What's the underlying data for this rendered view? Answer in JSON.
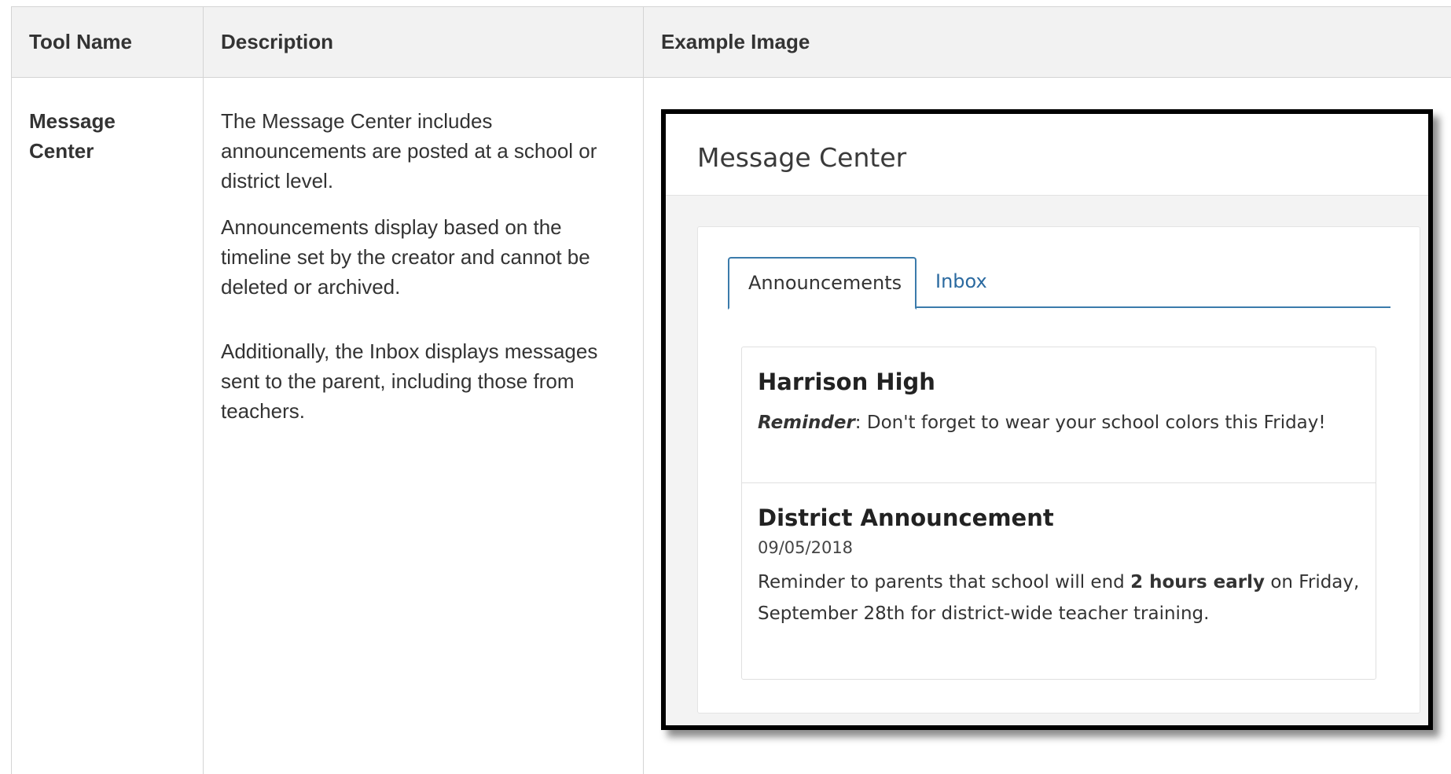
{
  "table": {
    "headers": {
      "tool_name": "Tool Name",
      "description": "Description",
      "example_image": "Example Image"
    },
    "rows": [
      {
        "tool_name": "Message Center",
        "description": [
          "The Message Center includes announcements are posted at a school or district level.",
          "Announcements display based on the timeline set by the creator and cannot be deleted or archived.",
          "Additionally, the Inbox displays messages sent to the parent, including those from teachers."
        ]
      }
    ]
  },
  "example": {
    "title": "Message Center",
    "tabs": [
      {
        "label": "Announcements",
        "active": true
      },
      {
        "label": "Inbox",
        "active": false
      }
    ],
    "announcements": [
      {
        "title": "Harrison High",
        "lead_bold_italic": "Reminder",
        "body": ": Don't forget to wear your school colors this Friday!"
      },
      {
        "title": "District Announcement",
        "date": "09/05/2018",
        "body_before": "Reminder to parents that school will end ",
        "body_bold": "2 hours early",
        "body_after": " on Friday, September 28th for district-wide teacher training."
      }
    ],
    "colors": {
      "tab_accent": "#3b7bab",
      "inbox_link": "#2b6aa0",
      "frame": "#000000"
    }
  }
}
